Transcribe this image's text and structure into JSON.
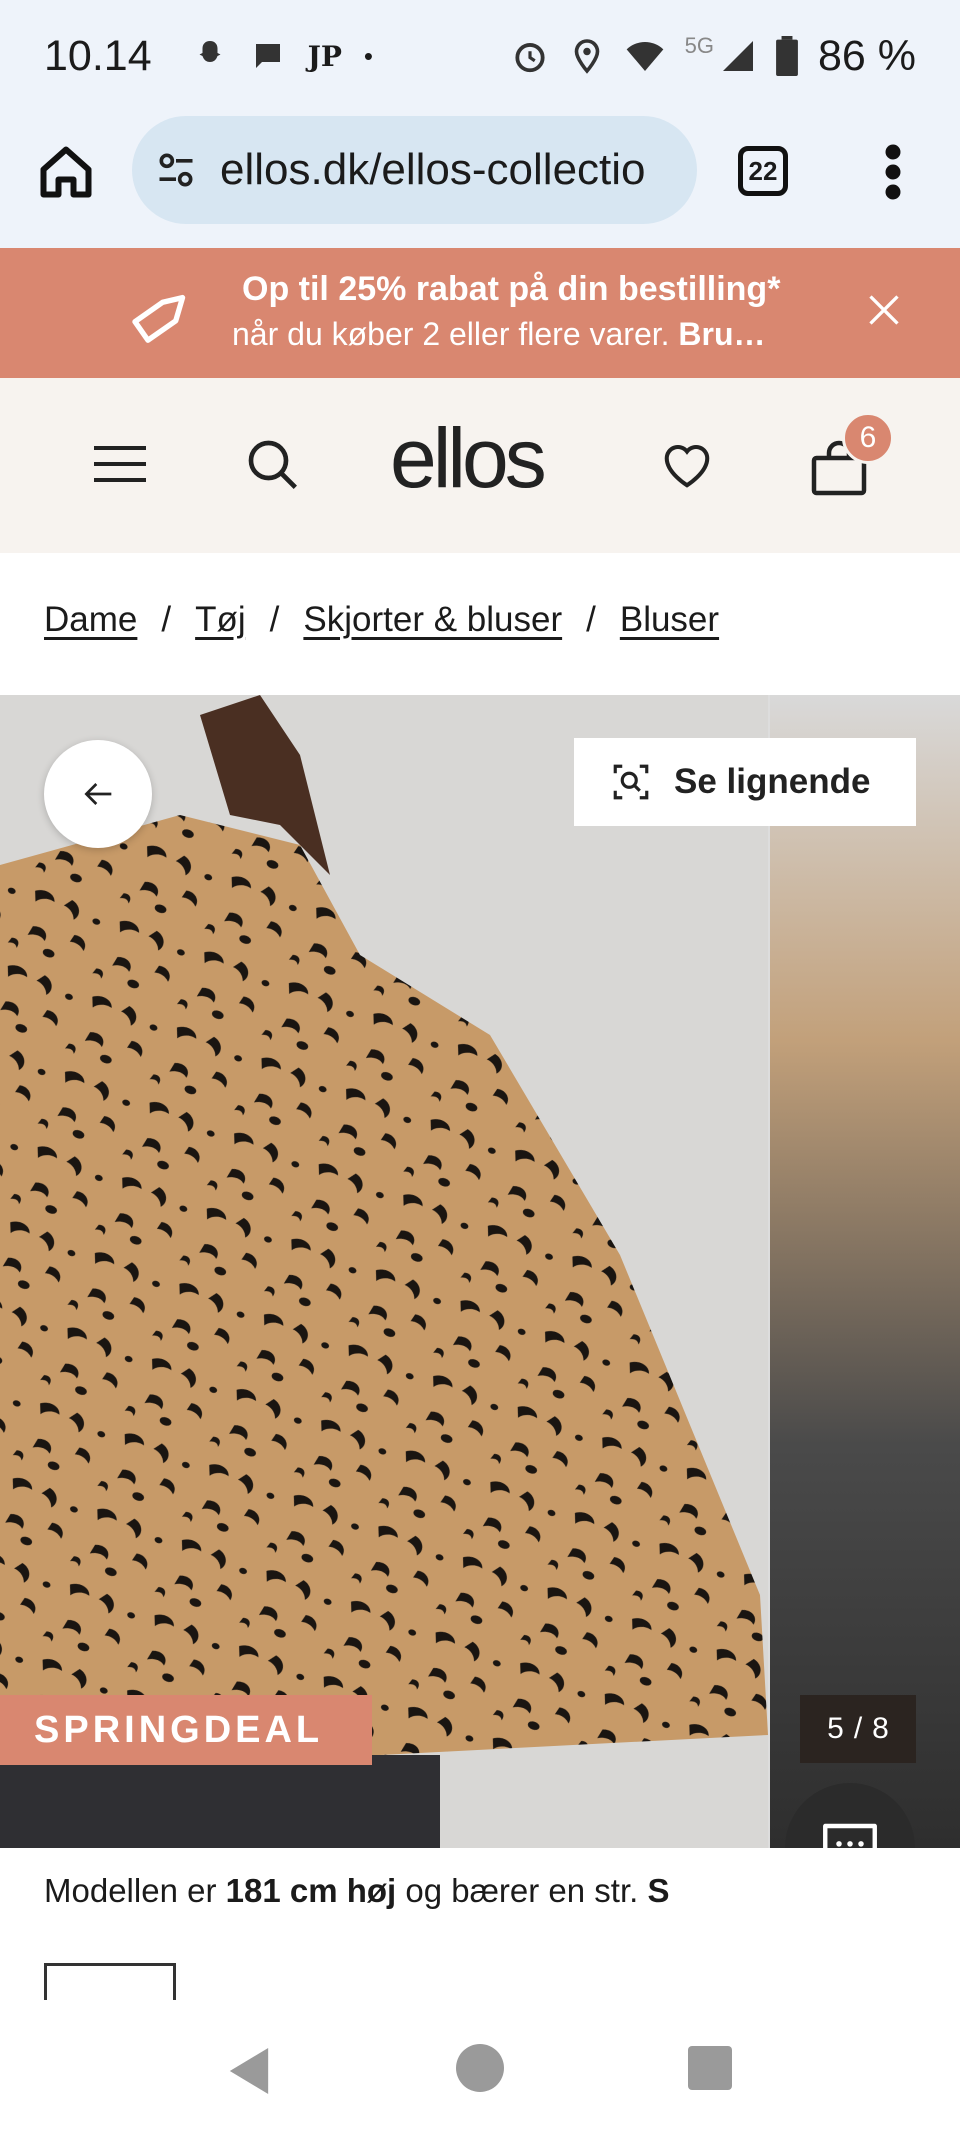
{
  "status_bar": {
    "time": "10.14",
    "notification_text": "JP",
    "network": "5G",
    "battery": "86 %"
  },
  "browser": {
    "url": "ellos.dk/ellos-collectio",
    "tab_count": "22"
  },
  "promo": {
    "headline": "Op til 25% rabat på din bestilling*",
    "subline": "når du køber 2 eller flere varer.",
    "subline_bold": "Bru…"
  },
  "header": {
    "logo": "ellos",
    "cart_count": "6"
  },
  "breadcrumb": {
    "items": [
      "Dame",
      "Tøj",
      "Skjorter & bluser",
      "Bluser"
    ],
    "separator": "/"
  },
  "gallery": {
    "similar_label": "Se lignende",
    "badge": "SPRINGDEAL",
    "current": "5",
    "separator": "/",
    "total": "8"
  },
  "model_info": {
    "prefix": "Modellen er ",
    "height": "181 cm høj",
    "middle": " og bærer en str. ",
    "size": "S"
  },
  "colors": {
    "accent": "#d98770",
    "header_bg": "#f7f3ef",
    "browser_bg": "#eef3fa"
  }
}
